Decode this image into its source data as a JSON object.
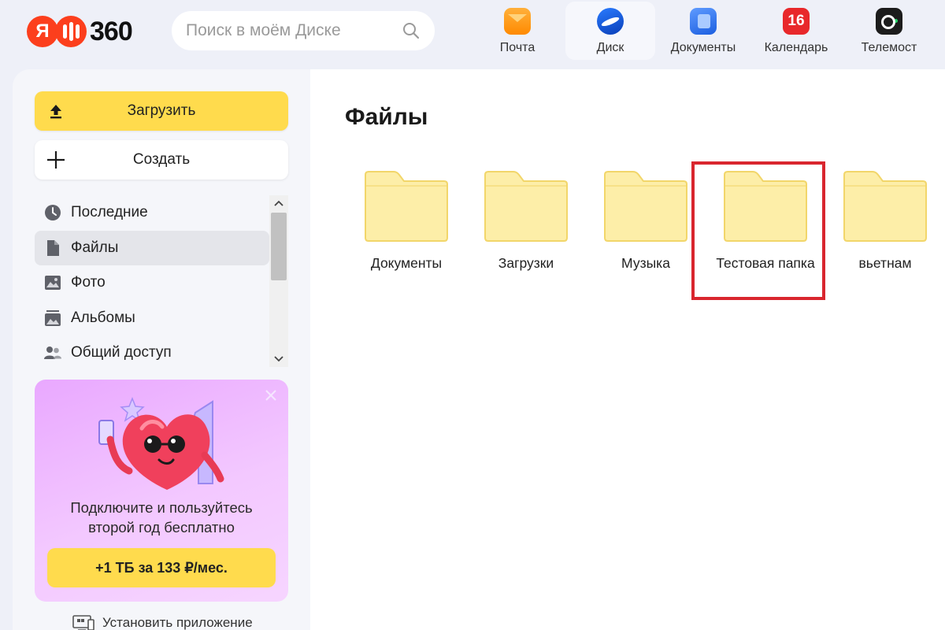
{
  "header": {
    "logo_ya": "Я",
    "logo_360": "360",
    "search": {
      "placeholder": "Поиск в моём Диске"
    },
    "services": [
      {
        "label": "Почта",
        "icon": "mail-icon"
      },
      {
        "label": "Диск",
        "icon": "disk-icon",
        "active": true
      },
      {
        "label": "Документы",
        "icon": "documents-icon"
      },
      {
        "label": "Календарь",
        "icon": "calendar-icon",
        "badge": "16"
      },
      {
        "label": "Телемост",
        "icon": "telemost-icon"
      }
    ]
  },
  "sidebar": {
    "upload_label": "Загрузить",
    "create_label": "Создать",
    "nav": [
      {
        "label": "Последние",
        "icon": "clock-icon"
      },
      {
        "label": "Файлы",
        "icon": "file-icon",
        "active": true
      },
      {
        "label": "Фото",
        "icon": "photo-icon"
      },
      {
        "label": "Альбомы",
        "icon": "albums-icon"
      },
      {
        "label": "Общий доступ",
        "icon": "shared-access-icon"
      }
    ],
    "promo": {
      "text_line1": "Подключите и пользуйтесь",
      "text_line2": "второй год бесплатно",
      "button_label": "+1 ТБ за 133 ₽/мес."
    },
    "install_label": "Установить приложение"
  },
  "main": {
    "title": "Файлы",
    "folders": [
      {
        "name": "Документы"
      },
      {
        "name": "Загрузки"
      },
      {
        "name": "Музыка"
      },
      {
        "name": "Тестовая папка",
        "highlighted": true
      },
      {
        "name": "вьетнам"
      }
    ]
  },
  "colors": {
    "accent_yellow": "#ffdb4d",
    "folder_fill": "#fdeea8",
    "folder_stroke": "#f2d66a",
    "highlight_red": "#d9262e",
    "logo_red": "#fc3f1d"
  }
}
